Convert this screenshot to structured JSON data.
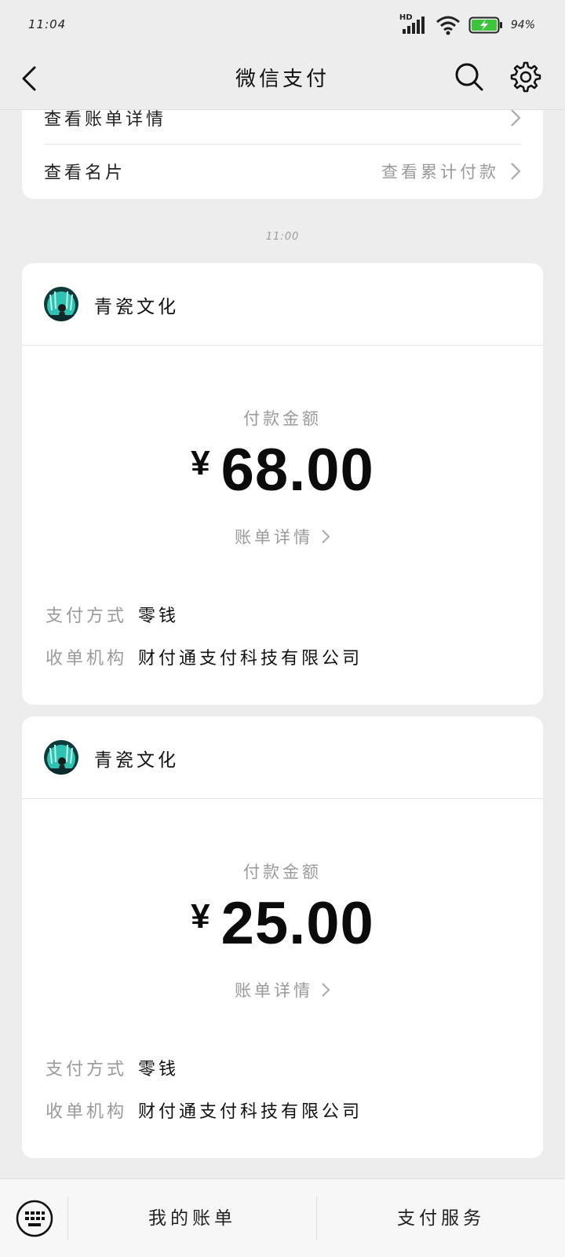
{
  "status_bar": {
    "time": "11:04",
    "battery_percent": "94%"
  },
  "nav": {
    "title": "微信支付"
  },
  "top_card": {
    "row1_label": "查看账单详情",
    "row2_label": "查看名片",
    "row2_right": "查看累计付款"
  },
  "time_divider": "11:00",
  "payments": [
    {
      "merchant": "青瓷文化",
      "amount_label": "付款金额",
      "currency": "¥",
      "amount": "68.00",
      "bill_detail": "账单详情",
      "method_key": "支付方式",
      "method_value": "零钱",
      "acquirer_key": "收单机构",
      "acquirer_value": "财付通支付科技有限公司"
    },
    {
      "merchant": "青瓷文化",
      "amount_label": "付款金额",
      "currency": "¥",
      "amount": "25.00",
      "bill_detail": "账单详情",
      "method_key": "支付方式",
      "method_value": "零钱",
      "acquirer_key": "收单机构",
      "acquirer_value": "财付通支付科技有限公司"
    }
  ],
  "bottom_bar": {
    "my_bills": "我的账单",
    "pay_services": "支付服务"
  },
  "colors": {
    "background": "#ededed",
    "card": "#ffffff",
    "muted_text": "#9a9a9a",
    "battery_green": "#3cc43c"
  }
}
